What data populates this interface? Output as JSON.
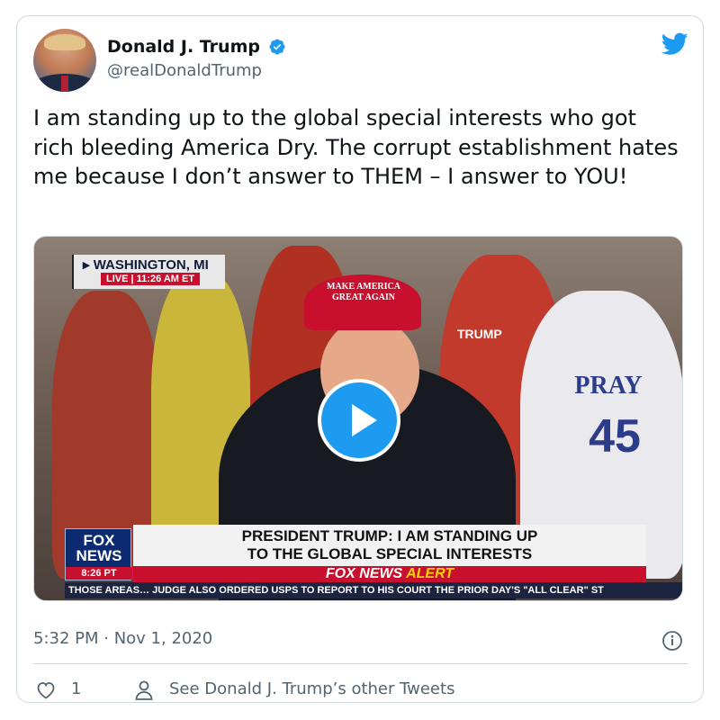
{
  "author": {
    "display_name": "Donald J. Trump",
    "handle": "@realDonaldTrump",
    "verified": true,
    "avatar_icon": "profile-photo"
  },
  "brand_icon": "twitter-bird-icon",
  "tweet": {
    "text": "I am standing up to the global special interests who got rich bleeding America Dry. The corrupt establishment hates me because I don’t answer to THEM – I answer to YOU!"
  },
  "media": {
    "type": "video",
    "play_icon": "play-icon",
    "location": "WASHINGTON, MI",
    "live_label": "LIVE",
    "live_time": "11:26 AM ET",
    "cap_text": "MAKE AMERICA GREAT AGAIN",
    "shirt_text": "PRAY",
    "shirt_number": "45",
    "sign_text": "TRUMP",
    "network_logo": "FOX NEWS",
    "network_time": "8:26 PT",
    "headline_line1": "PRESIDENT TRUMP: I AM STANDING UP",
    "headline_line2": "TO THE GLOBAL SPECIAL INTERESTS",
    "alert_brand": "FOX NEWS",
    "alert_word": "ALERT",
    "ticker": "THOSE AREAS…   JUDGE ALSO ORDERED USPS TO REPORT TO HIS COURT THE PRIOR DAY'S \"ALL CLEAR\" ST"
  },
  "meta": {
    "timestamp": "5:32 PM · Nov 1, 2020",
    "info_icon": "info-icon"
  },
  "actions": {
    "like_count": "1",
    "other_tweets_label": "See Donald J. Trump’s other Tweets"
  },
  "colors": {
    "accent": "#1d9bf0",
    "text_primary": "#0f1419",
    "text_secondary": "#536471",
    "border": "#cfd9de",
    "fox_red": "#c8102e",
    "fox_blue": "#0b2a6f"
  }
}
